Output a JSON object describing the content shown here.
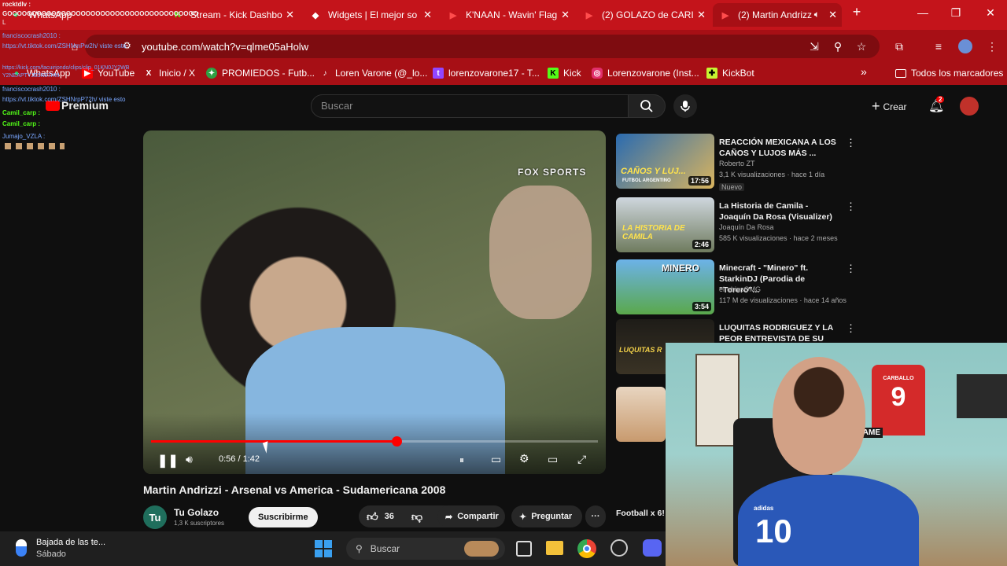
{
  "tabs": [
    {
      "label": "WhatsApp",
      "icon": "whatsapp-icon",
      "color": "#25d366"
    },
    {
      "label": "Stream - Kick Dashbo",
      "icon": "kick-icon",
      "color": "#53fc18"
    },
    {
      "label": "Widgets | El mejor so",
      "icon": "widget-icon",
      "color": "#ffffff"
    },
    {
      "label": "K'NAAN - Wavin' Flag",
      "icon": "youtube-icon",
      "color": "#ff0000"
    },
    {
      "label": "(2) GOLAZO de CARI",
      "icon": "youtube-icon",
      "color": "#ff0000"
    },
    {
      "label": "(2) Martin Andrizz",
      "icon": "youtube-icon",
      "color": "#ff0000"
    }
  ],
  "new_tab": "+",
  "address": {
    "url": "youtube.com/watch?v=qlme05aHolw"
  },
  "bookmarks": [
    {
      "label": "WhatsApp",
      "icon": "whatsapp-icon",
      "color": "#25d366"
    },
    {
      "label": "YouTube",
      "icon": "youtube-icon",
      "color": "#ff0000"
    },
    {
      "label": "Inicio / X",
      "icon": "x-icon",
      "color": "#000000"
    },
    {
      "label": "PROMIEDOS - Futb...",
      "icon": "promiedos-icon",
      "color": "#2ea043"
    },
    {
      "label": "Loren Varone (@_lo...",
      "icon": "tiktok-icon",
      "color": "#000000"
    },
    {
      "label": "lorenzovarone17 - T...",
      "icon": "twitch-icon",
      "color": "#9146ff"
    },
    {
      "label": "Kick",
      "icon": "kick-icon",
      "color": "#53fc18"
    },
    {
      "label": "Lorenzovarone (Inst...",
      "icon": "instagram-icon",
      "color": "#e1306c"
    },
    {
      "label": "KickBot",
      "icon": "kickbot-icon",
      "color": "#c6f432"
    }
  ],
  "bookmarks_more": "»",
  "all_bookmarks": "Todos los marcadores",
  "yt": {
    "logo": "Premium",
    "search_placeholder": "Buscar",
    "create": "Crear",
    "notif_count": "2"
  },
  "chat": [
    {
      "user": "rocktdlv :",
      "text": "",
      "color": "#ffffff"
    },
    {
      "user": "",
      "text": "GOOOOOOOOOOOOOOOOOOOOOOOOOOOOOOOOOOOOOOO",
      "color": "#ffffff"
    },
    {
      "user": "L",
      "text": "",
      "color": "#ffffff"
    },
    {
      "user": "franciscocrash2010 :",
      "text": "",
      "color": "#7aa7ff"
    },
    {
      "user": "",
      "text": "https://vt.tiktok.com/ZSHNmPw2h/ viste esto",
      "color": "#7aa7ff"
    },
    {
      "user": "",
      "text": "https://kick.com/facuiriondo/clips/clip_01KN0JY2WB",
      "color": "#7aa7ff"
    },
    {
      "user": "",
      "text": "Y2NEAPTYJE5N97HM",
      "color": "#7aa7ff"
    },
    {
      "user": "franciscocrash2010 :",
      "text": "",
      "color": "#7aa7ff"
    },
    {
      "user": "",
      "text": "https://vt.tiktok.com/ZSHNrpP72h/ viste esto",
      "color": "#7aa7ff"
    },
    {
      "user": "Camil_carp :",
      "text": "",
      "color": "#53fc18"
    },
    {
      "user": "Camil_carp :",
      "text": "",
      "color": "#53fc18"
    },
    {
      "user": "Jumajo_VZLA :",
      "text": "",
      "color": "#7aa7ff"
    }
  ],
  "video": {
    "watermark": "FOX SPORTS",
    "time": "0:56 / 1:42",
    "progress": 0.55,
    "title": "Martin Andrizzi - Arsenal vs America - Sudamericana 2008"
  },
  "channel": {
    "avatar": "Tu",
    "name": "Tu Golazo",
    "subs": "1,3 K suscriptores",
    "subscribe": "Suscribirme"
  },
  "actions": {
    "likes": "36",
    "share": "Compartir",
    "ask": "Preguntar",
    "more": "···"
  },
  "recs": [
    {
      "title": "REACCIÓN MEXICANA A LOS CAÑOS Y LUJOS MÁS ...",
      "channel": "Roberto ZT",
      "meta": "3,1 K visualizaciones · hace 1 día",
      "badge": "Nuevo",
      "duration": "17:56",
      "thumb_text": "CAÑOS Y LUJ...",
      "thumb_sub": "FUTBOL ARGENTINO"
    },
    {
      "title": "La Historia de Camila - Joaquín Da Rosa (Visualizer)",
      "channel": "Joaquín Da Rosa",
      "meta": "585 K visualizaciones · hace 2 meses",
      "badge": "",
      "duration": "2:46",
      "thumb_text": "LA HISTORIA DE CAMILA",
      "thumb_sub": ""
    },
    {
      "title": "Minecraft - \"Minero\" ft. StarkinDJ (Parodia de \"Torero\"...",
      "channel": "elrubiusOMG",
      "meta": "117 M de visualizaciones · hace 14 años",
      "badge": "",
      "duration": "3:54",
      "thumb_text": "MINERO",
      "thumb_sub": ""
    },
    {
      "title": "LUQUITAS RODRIGUEZ Y LA PEOR ENTREVISTA DE SU VID...",
      "channel": "",
      "meta": "",
      "badge": "",
      "duration": "",
      "thumb_text": "LUQUITAS R",
      "thumb_sub": ""
    }
  ],
  "rec_partial_title": "Football x 6!",
  "taskbar": {
    "weather_title": "Bajada de las te...",
    "weather_sub": "Sábado",
    "search": "Buscar"
  },
  "webcam": {
    "jersey_number": "10",
    "jersey_brand": "adidas",
    "shirt_number": "9",
    "shirt_name": "CARBALLO",
    "game_sign": "GAME"
  }
}
